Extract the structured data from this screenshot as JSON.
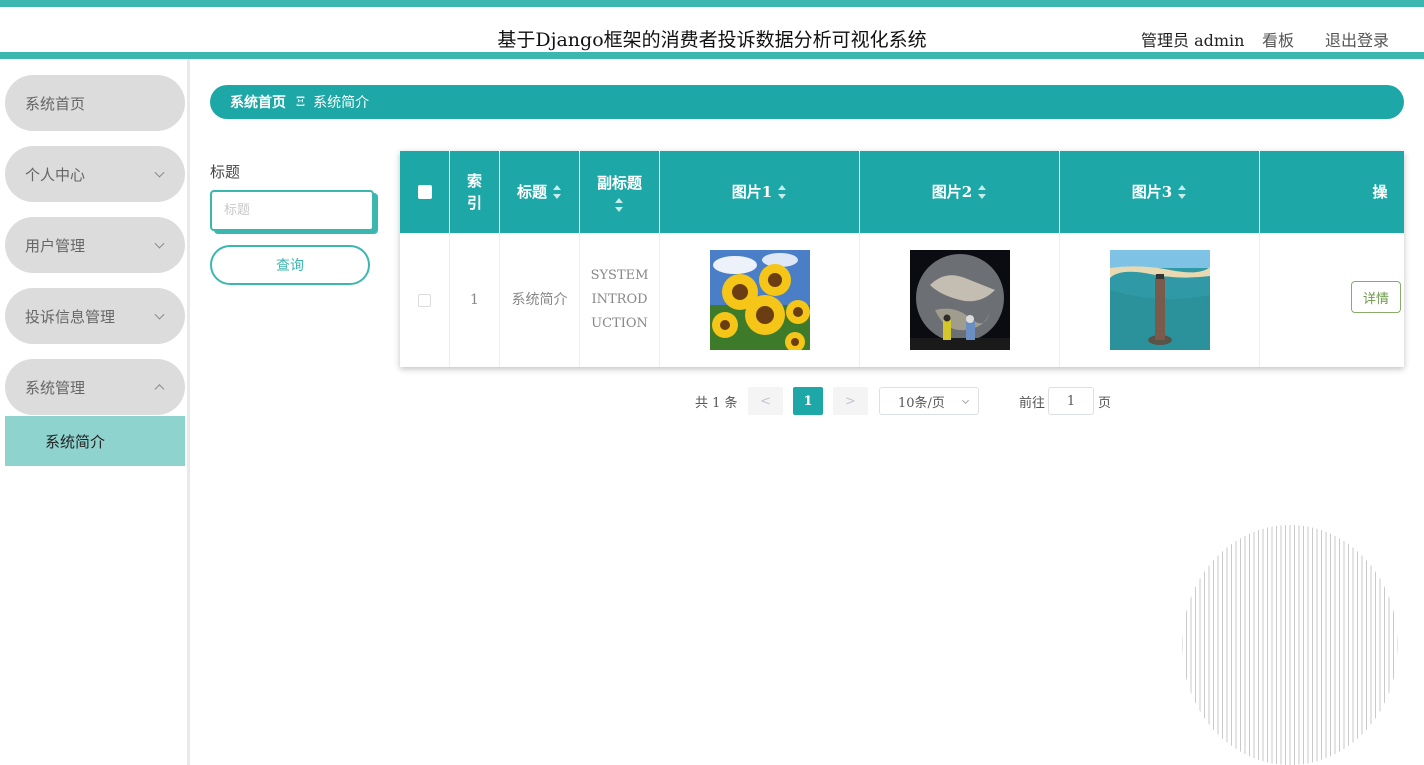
{
  "header": {
    "title": "基于Django框架的消费者投诉数据分析可视化系统",
    "user": "管理员 admin",
    "board": "看板",
    "logout": "退出登录"
  },
  "sidebar": {
    "items": [
      {
        "label": "系统首页"
      },
      {
        "label": "个人中心"
      },
      {
        "label": "用户管理"
      },
      {
        "label": "投诉信息管理"
      },
      {
        "label": "系统管理"
      }
    ],
    "sub_items": [
      {
        "label": "系统简介"
      }
    ]
  },
  "breadcrumb": {
    "home": "系统首页",
    "separator": "Ξ",
    "current": "系统简介"
  },
  "search": {
    "label": "标题",
    "placeholder": "标题",
    "button": "查询"
  },
  "table": {
    "headers": {
      "index_line1": "索",
      "index_line2": "引",
      "title": "标题",
      "subtitle": "副标题",
      "pic1": "图片1",
      "pic2": "图片2",
      "pic3": "图片3",
      "action": "操"
    },
    "rows": [
      {
        "index": "1",
        "title": "系统简介",
        "subtitle_line1": "SYSTEM",
        "subtitle_line2": "INTROD",
        "subtitle_line3": "UCTION",
        "detail": "详情"
      }
    ]
  },
  "pagination": {
    "total": "共 1 条",
    "prev": "<",
    "current_page": "1",
    "next": ">",
    "page_size": "10条/页",
    "goto_label": "前往",
    "goto_value": "1",
    "goto_suffix": "页"
  },
  "colors": {
    "accent": "#1da7a6",
    "accent_light": "#3cb7b0",
    "submenu_active": "#8fd3cf",
    "menu_bg": "#dcdcdc"
  }
}
